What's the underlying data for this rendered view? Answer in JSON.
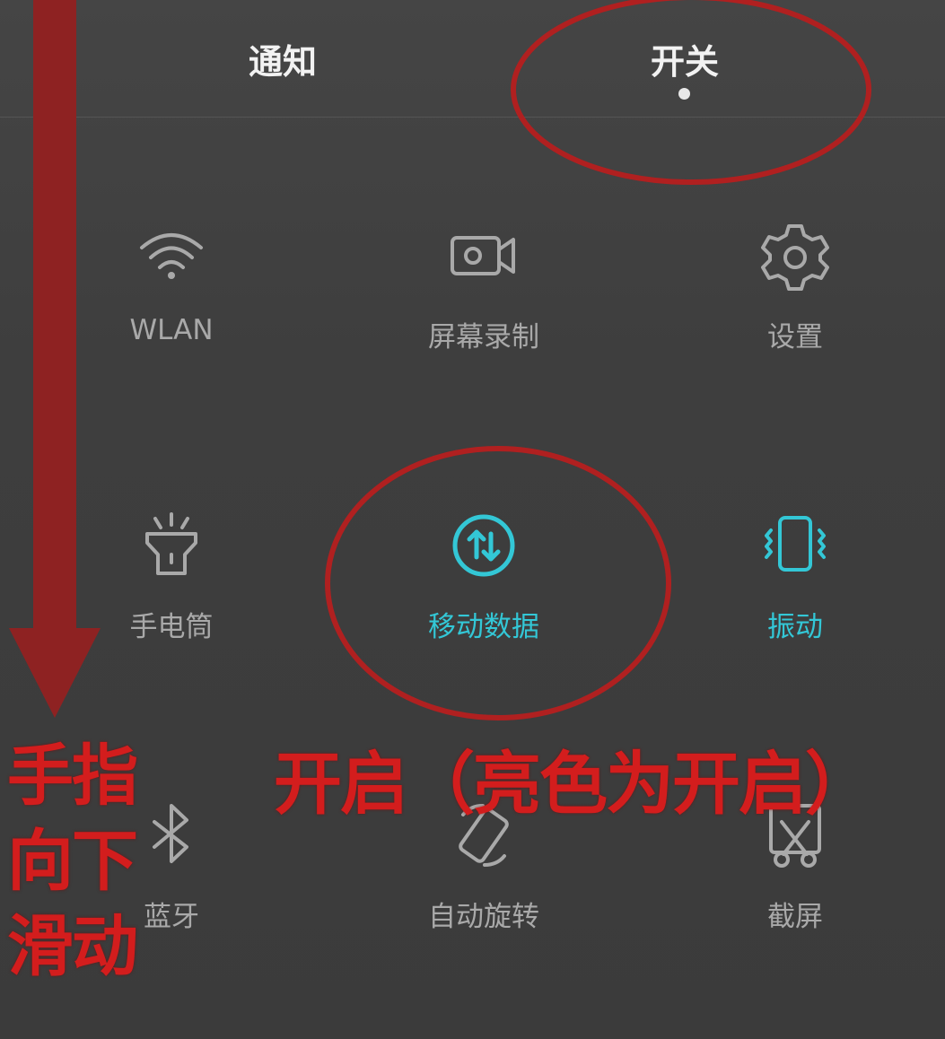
{
  "tabs": {
    "notify": "通知",
    "switch": "开关"
  },
  "tiles": [
    {
      "label": "WLAN",
      "icon": "wifi-icon",
      "active": false
    },
    {
      "label": "屏幕录制",
      "icon": "screen-record-icon",
      "active": false
    },
    {
      "label": "设置",
      "icon": "gear-icon",
      "active": false
    },
    {
      "label": "手电筒",
      "icon": "flashlight-icon",
      "active": false
    },
    {
      "label": "移动数据",
      "icon": "mobile-data-icon",
      "active": true
    },
    {
      "label": "振动",
      "icon": "vibrate-icon",
      "active": true
    },
    {
      "label": "蓝牙",
      "icon": "bluetooth-icon",
      "active": false
    },
    {
      "label": "自动旋转",
      "icon": "auto-rotate-icon",
      "active": false
    },
    {
      "label": "截屏",
      "icon": "screenshot-icon",
      "active": false
    }
  ],
  "annotations": {
    "side_lines": [
      "手指",
      "向下",
      "滑动"
    ],
    "main": "开启（亮色为开启）"
  },
  "colors": {
    "active": "#33c7d6",
    "inactive": "#a9a9a9",
    "annotation": "#d31d1d"
  }
}
